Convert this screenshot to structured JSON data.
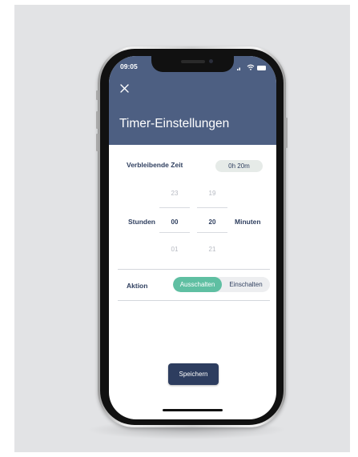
{
  "status_bar": {
    "time": "09:05"
  },
  "header": {
    "title": "Timer-Einstellungen"
  },
  "remaining": {
    "label": "Verbleibende Zeit",
    "value": "0h 20m"
  },
  "picker": {
    "hours_label": "Stunden",
    "minutes_label": "Minuten",
    "hours_above": "23",
    "hours_selected": "00",
    "hours_below": "01",
    "minutes_above": "19",
    "minutes_selected": "20",
    "minutes_below": "21"
  },
  "action": {
    "label": "Aktion",
    "option_off": "Ausschalten",
    "option_on": "Einschalten",
    "selected": "Ausschalten"
  },
  "save_label": "Speichern",
  "colors": {
    "header": "#4d5f82",
    "accent": "#5fbfa2",
    "button": "#2d3d5f"
  }
}
